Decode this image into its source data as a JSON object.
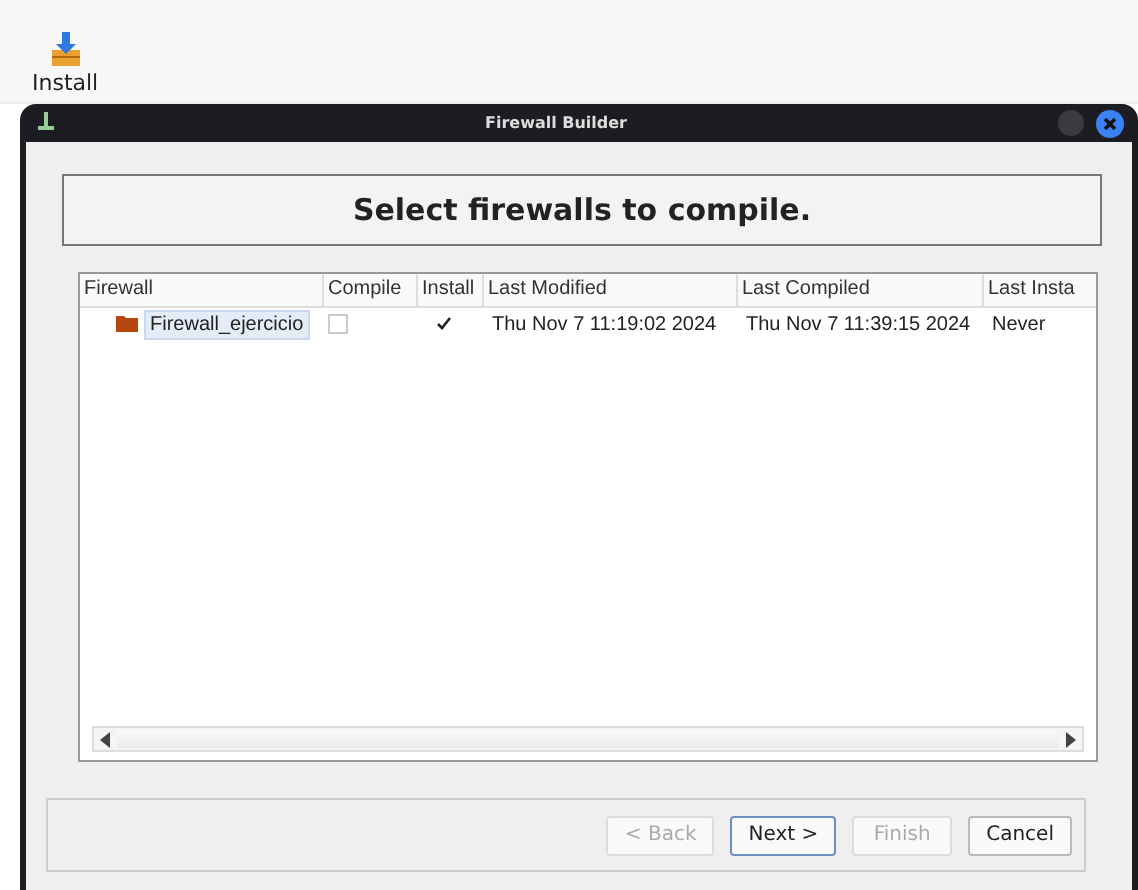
{
  "toolbar": {
    "items": [
      {
        "label": "Install"
      }
    ]
  },
  "window": {
    "title": "Firewall Builder"
  },
  "header": "Select firewalls to compile.",
  "table": {
    "columns": [
      "Firewall",
      "Compile",
      "Install",
      "Last Modified",
      "Last Compiled",
      "Last Insta"
    ],
    "rows": [
      {
        "name": "Firewall_ejercicio",
        "selected": true,
        "compile": false,
        "install": true,
        "last_modified": "Thu Nov 7 11:19:02 2024",
        "last_compiled": "Thu Nov 7 11:39:15 2024",
        "last_installed": "Never"
      }
    ]
  },
  "buttons": [
    {
      "label": "< Back",
      "disabled": true,
      "default": false
    },
    {
      "label": "Next >",
      "disabled": false,
      "default": true
    },
    {
      "label": "Finish",
      "disabled": true,
      "default": false
    },
    {
      "label": "Cancel",
      "disabled": false,
      "default": false
    }
  ]
}
